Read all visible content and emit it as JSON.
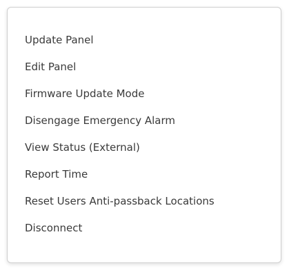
{
  "menu": {
    "items": [
      {
        "label": "Update Panel"
      },
      {
        "label": "Edit Panel"
      },
      {
        "label": "Firmware Update Mode"
      },
      {
        "label": "Disengage Emergency Alarm"
      },
      {
        "label": "View Status (External)"
      },
      {
        "label": "Report Time"
      },
      {
        "label": "Reset Users Anti-passback Locations"
      },
      {
        "label": "Disconnect"
      }
    ]
  }
}
